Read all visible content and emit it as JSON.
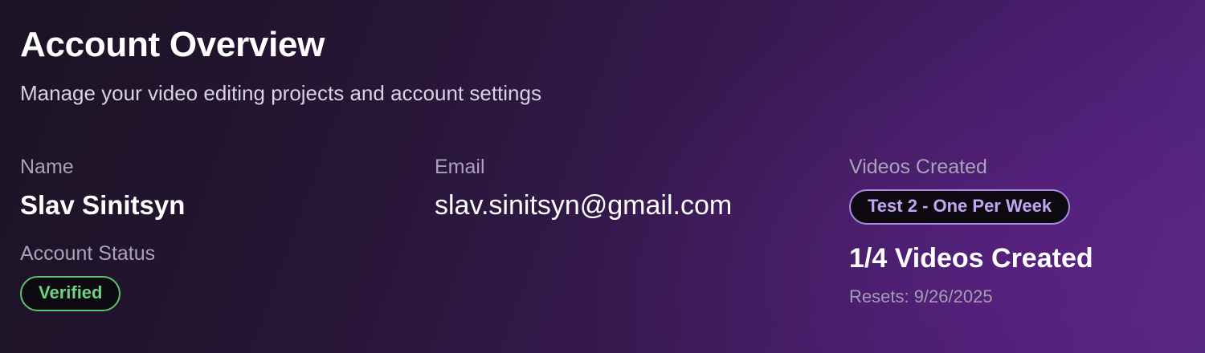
{
  "header": {
    "title": "Account Overview",
    "subtitle": "Manage your video editing projects and account settings"
  },
  "profile": {
    "name_label": "Name",
    "name_value": "Slav Sinitsyn",
    "email_label": "Email",
    "email_value": "slav.sinitsyn@gmail.com",
    "status_label": "Account Status",
    "status_badge": "Verified"
  },
  "videos": {
    "label": "Videos Created",
    "plan_badge": "Test 2 - One Per Week",
    "count_text": "1/4 Videos Created",
    "used": 1,
    "limit": 4,
    "resets_text": "Resets: 9/26/2025"
  },
  "colors": {
    "verified_green": "#6fd382",
    "plan_purple": "#c2a6f2",
    "background_dark": "#1b1324",
    "background_purple": "#4a1d70"
  }
}
